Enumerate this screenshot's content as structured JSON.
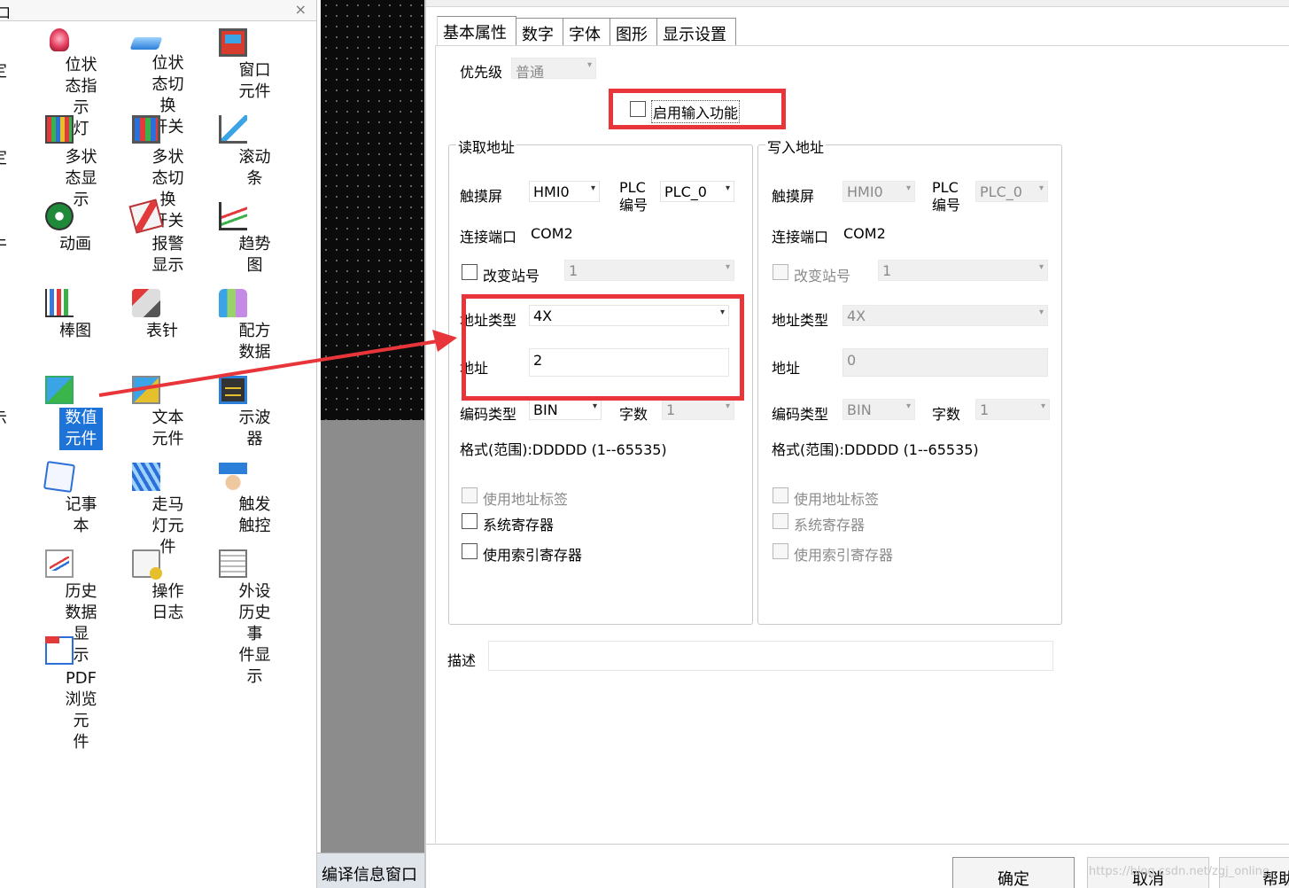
{
  "toolbox": {
    "title": "口",
    "close": "×",
    "partial_labels": [
      "定",
      "定",
      "牛",
      "示"
    ],
    "items": [
      {
        "label": "位状态指示\n灯",
        "icon": "bulb-icon"
      },
      {
        "label": "位状态切换\n开关",
        "icon": "switch-icon"
      },
      {
        "label": "窗口元件",
        "icon": "window-icon"
      },
      {
        "label": "多状态显示",
        "icon": "multistate-display-icon"
      },
      {
        "label": "多状态切换\n开关",
        "icon": "multistate-switch-icon"
      },
      {
        "label": "滚动条",
        "icon": "scrollbar-icon"
      },
      {
        "label": "动画",
        "icon": "animation-icon"
      },
      {
        "label": "报警显示",
        "icon": "alarm-icon"
      },
      {
        "label": "趋势图",
        "icon": "trend-icon"
      },
      {
        "label": "棒图",
        "icon": "bar-chart-icon"
      },
      {
        "label": "表针",
        "icon": "meter-icon"
      },
      {
        "label": "配方数据",
        "icon": "recipe-icon"
      },
      {
        "label": "数值元件",
        "icon": "numeric-icon",
        "selected": true
      },
      {
        "label": "文本元件",
        "icon": "text-element-icon"
      },
      {
        "label": "示波器",
        "icon": "oscilloscope-icon"
      },
      {
        "label": "记事本",
        "icon": "notepad-icon"
      },
      {
        "label": "走马灯元件",
        "icon": "marquee-icon"
      },
      {
        "label": "触发触控",
        "icon": "touch-icon"
      },
      {
        "label": "历史数据显\n示",
        "icon": "history-icon"
      },
      {
        "label": "操作日志",
        "icon": "log-icon"
      },
      {
        "label": "外设历史事\n件显示",
        "icon": "external-history-icon"
      },
      {
        "label": "PDF浏览元\n件",
        "icon": "pdf-icon"
      }
    ]
  },
  "compile_tab": "编译信息窗口",
  "dialog": {
    "tabs": [
      "基本属性",
      "数字",
      "字体",
      "图形",
      "显示设置"
    ],
    "priority_label": "优先级",
    "priority_value": "普通",
    "enable_input_label": "启用输入功能",
    "read": {
      "group_title": "读取地址",
      "hmi_label": "触摸屏",
      "hmi_value": "HMI0",
      "plc_label_1": "PLC",
      "plc_label_2": "编号",
      "plc_value": "PLC_0",
      "port_label": "连接端口",
      "port_value": "COM2",
      "change_station_label": "改变站号",
      "station_value": "1",
      "addr_type_label": "地址类型",
      "addr_type_value": "4X",
      "addr_label": "地址",
      "addr_value": "2",
      "encoding_label": "编码类型",
      "encoding_value": "BIN",
      "words_label": "字数",
      "words_value": "1",
      "format_text": "格式(范围):DDDDD (1--65535)",
      "use_tag_label": "使用地址标签",
      "system_reg_label": "系统寄存器",
      "index_reg_label": "使用索引寄存器"
    },
    "write": {
      "group_title": "写入地址",
      "hmi_label": "触摸屏",
      "hmi_value": "HMI0",
      "plc_label_1": "PLC",
      "plc_label_2": "编号",
      "plc_value": "PLC_0",
      "port_label": "连接端口",
      "port_value": "COM2",
      "change_station_label": "改变站号",
      "station_value": "1",
      "addr_type_label": "地址类型",
      "addr_type_value": "4X",
      "addr_label": "地址",
      "addr_value": "0",
      "encoding_label": "编码类型",
      "encoding_value": "BIN",
      "words_label": "字数",
      "words_value": "1",
      "format_text": "格式(范围):DDDDD (1--65535)",
      "use_tag_label": "使用地址标签",
      "system_reg_label": "系统寄存器",
      "index_reg_label": "使用索引寄存器"
    },
    "description_label": "描述",
    "description_value": "",
    "ok_label": "确定",
    "cancel_label": "取消",
    "help_label": "帮助"
  },
  "watermark": "https://blog.csdn.net/zgj_online",
  "colors": {
    "highlight_red": "#e8353a",
    "selection_blue": "#1e73d8"
  }
}
